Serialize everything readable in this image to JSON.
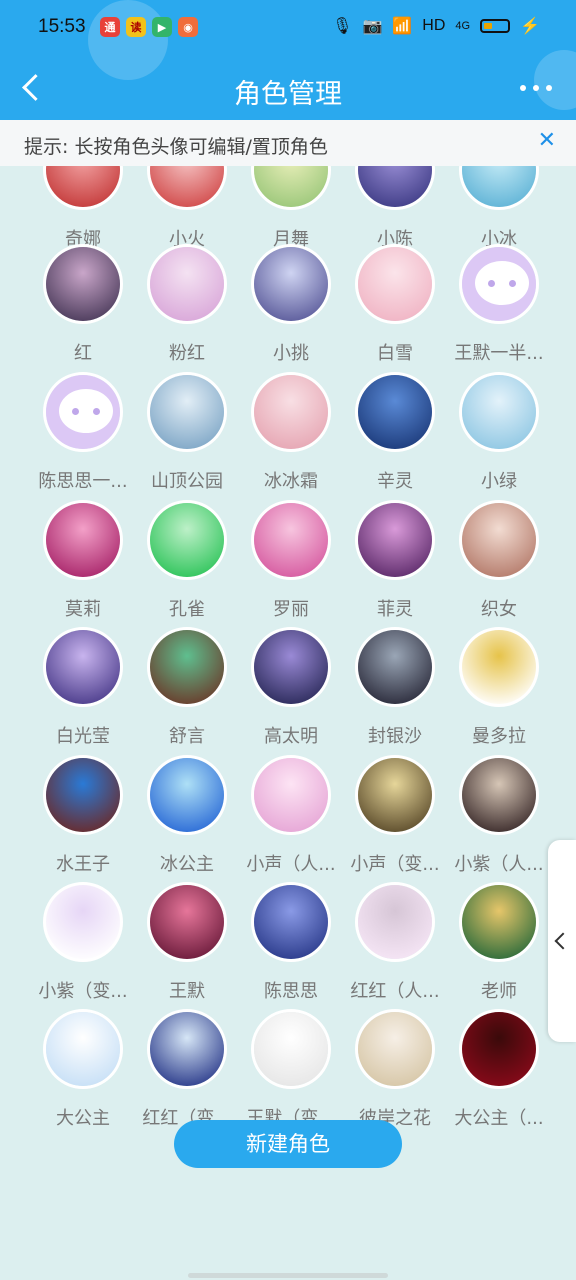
{
  "status_bar": {
    "time": "15:53",
    "hd_label": "HD",
    "net_label": "4G",
    "app_icons": [
      {
        "icon": "red-app-icon",
        "glyph": "通",
        "color": "#e8413a"
      },
      {
        "icon": "yellow-app-icon",
        "glyph": "读",
        "color": "#f2c21a"
      },
      {
        "icon": "play-store-icon",
        "glyph": "▶",
        "color": "#33b46a"
      },
      {
        "icon": "game-app-icon",
        "glyph": "◉",
        "color": "#f06d3b"
      }
    ]
  },
  "header": {
    "title": "角色管理",
    "background": "#2aa9ee"
  },
  "tip": {
    "text": "提示: 长按角色头像可编辑/置顶角色",
    "close_glyph": "✕"
  },
  "characters": [
    {
      "name": "奇娜",
      "colors": [
        "#c43a3a",
        "#f3a3a3"
      ]
    },
    {
      "name": "小火",
      "colors": [
        "#d14a4a",
        "#f6c5c5"
      ]
    },
    {
      "name": "月舞",
      "colors": [
        "#9bc77a",
        "#e9efb9"
      ]
    },
    {
      "name": "小陈",
      "colors": [
        "#3f3c86",
        "#9a8fd6"
      ]
    },
    {
      "name": "小冰",
      "colors": [
        "#5fb3d6",
        "#c6ecf7"
      ]
    },
    {
      "name": "红",
      "colors": [
        "#4a3a5a",
        "#c9a6c9"
      ]
    },
    {
      "name": "粉红",
      "colors": [
        "#d9a7d9",
        "#f4e2f2"
      ]
    },
    {
      "name": "小挑",
      "colors": [
        "#5a5a9a",
        "#cfd4f2"
      ]
    },
    {
      "name": "白雪",
      "colors": [
        "#f0b4c4",
        "#fbe4ea"
      ]
    },
    {
      "name": "王默一半...",
      "colors": [
        "#dcc8f5",
        "#dcc8f5"
      ],
      "chat": true
    },
    {
      "name": "陈思思一...",
      "colors": [
        "#dcc8f5",
        "#dcc8f5"
      ],
      "chat": true
    },
    {
      "name": "山顶公园",
      "colors": [
        "#7ea6c6",
        "#e2eef6"
      ]
    },
    {
      "name": "冰冰霜",
      "colors": [
        "#e6a6b3",
        "#f8dfe4"
      ]
    },
    {
      "name": "辛灵",
      "colors": [
        "#1c3a7a",
        "#5a8ad6"
      ]
    },
    {
      "name": "小绿",
      "colors": [
        "#8fc7e3",
        "#e3f2fa"
      ]
    },
    {
      "name": "莫莉",
      "colors": [
        "#a8256a",
        "#f3a0c8"
      ]
    },
    {
      "name": "孔雀",
      "colors": [
        "#2ec45a",
        "#bdf0c8"
      ]
    },
    {
      "name": "罗丽",
      "colors": [
        "#d65aa0",
        "#f7c5df"
      ]
    },
    {
      "name": "菲灵",
      "colors": [
        "#5c2a6a",
        "#d99ad9"
      ]
    },
    {
      "name": "织女",
      "colors": [
        "#b47a6a",
        "#f2dcd2"
      ]
    },
    {
      "name": "白光莹",
      "colors": [
        "#4a3b8a",
        "#c8b4ee"
      ]
    },
    {
      "name": "舒言",
      "colors": [
        "#6a3a2a",
        "#5fbf8f"
      ]
    },
    {
      "name": "高太明",
      "colors": [
        "#2b2a5a",
        "#9a8ad6"
      ]
    },
    {
      "name": "封银沙",
      "colors": [
        "#2a2a3a",
        "#9aa6b6"
      ]
    },
    {
      "name": "曼多拉",
      "colors": [
        "#ffffff",
        "#e6c34a"
      ],
      "plain": true
    },
    {
      "name": "水王子",
      "colors": [
        "#6a2a2a",
        "#2a7ad6"
      ]
    },
    {
      "name": "冰公主",
      "colors": [
        "#2a6ad6",
        "#aee0f6"
      ]
    },
    {
      "name": "小声（人...",
      "colors": [
        "#e6a6d6",
        "#fde4f4"
      ]
    },
    {
      "name": "小声（变...",
      "colors": [
        "#5a4a2a",
        "#e6d69a"
      ]
    },
    {
      "name": "小紫（人...",
      "colors": [
        "#3a2a2a",
        "#d6c6b6"
      ]
    },
    {
      "name": "小紫（变...",
      "colors": [
        "#ffffff",
        "#e6d6f6"
      ],
      "plain": true
    },
    {
      "name": "王默",
      "colors": [
        "#6a1a3a",
        "#e6769a"
      ]
    },
    {
      "name": "陈思思",
      "colors": [
        "#2a3a8a",
        "#8a9ae6"
      ]
    },
    {
      "name": "红红（人...",
      "colors": [
        "#f6e6f6",
        "#d6c6d6"
      ]
    },
    {
      "name": "老师",
      "colors": [
        "#2a6a3a",
        "#e6c66a"
      ]
    },
    {
      "name": "大公主",
      "colors": [
        "#c6dff6",
        "#ffffff"
      ]
    },
    {
      "name": "红红（变...",
      "colors": [
        "#2a3a8a",
        "#d6e6f6"
      ]
    },
    {
      "name": "王默（变...",
      "colors": [
        "#e6e6e6",
        "#ffffff"
      ]
    },
    {
      "name": "彼岸之花",
      "colors": [
        "#d6c6a6",
        "#f6efe6"
      ]
    },
    {
      "name": "大公主（...",
      "colors": [
        "#8a0a1a",
        "#3a0a0a"
      ]
    }
  ],
  "new_button": {
    "label": "新建角色"
  }
}
